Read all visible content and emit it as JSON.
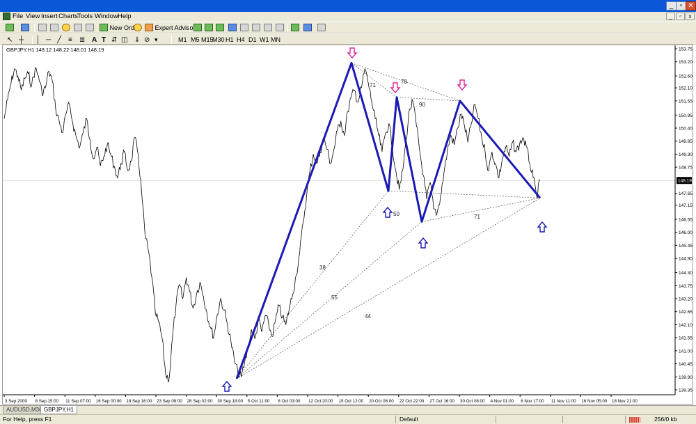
{
  "menu": {
    "items": [
      "File",
      "View",
      "Insert",
      "Charts",
      "Tools",
      "Window",
      "Help"
    ]
  },
  "toolbar": {
    "new_order_label": "New Order",
    "expert_advisors_label": "Expert Advisors",
    "timeframes": [
      "M1",
      "M5",
      "M15",
      "M30",
      "H1",
      "H4",
      "D1",
      "W1",
      "MN"
    ]
  },
  "chart": {
    "title": "GBPJPY,H1  148.12 148.22 148.01 148.19",
    "current_price_label": "148.19",
    "colors": {
      "price_line": "#000000",
      "pattern_line": "#1a1ab5",
      "down_arrow": "#e0249a",
      "up_arrow": "#1a1ab5",
      "ratio_line": "#555555",
      "price_tag_bg": "#000000"
    }
  },
  "chart_data": {
    "type": "line",
    "symbol": "GBPJPY",
    "timeframe": "H1",
    "ohlc": {
      "open": 148.12,
      "high": 148.22,
      "low": 148.01,
      "close": 148.19
    },
    "y_ticks": [
      "153.75",
      "153.20",
      "152.60",
      "152.10",
      "151.55",
      "150.95",
      "150.40",
      "149.85",
      "149.30",
      "148.75",
      "147.65",
      "147.15",
      "146.55",
      "146.00",
      "145.45",
      "144.90",
      "144.30",
      "143.75",
      "143.20",
      "142.65",
      "142.10",
      "141.55",
      "141.00",
      "140.45",
      "139.90",
      "139.35"
    ],
    "x_ticks": [
      "3 Sep 2009",
      "8 Sep 15:00",
      "11 Sep 07:00",
      "16 Sep 00:00",
      "18 Sep 16:00",
      "23 Sep 09:00",
      "28 Sep 02:00",
      "30 Sep 18:00",
      "5 Oct 11:00",
      "8 Oct 03:00",
      "12 Oct 20:00",
      "15 Oct 12:00",
      "20 Oct 06:00",
      "22 Oct 22:00",
      "27 Oct 16:00",
      "30 Oct 08:00",
      "4 Nov 01:00",
      "6 Nov 17:00",
      "11 Nov 11:00",
      "16 Nov 05:00",
      "18 Nov 21:00"
    ],
    "y_range": [
      139.35,
      153.75
    ],
    "current_price": 148.19,
    "pivots": [
      {
        "x": "7 Oct",
        "y": 139.82,
        "kind": "low"
      },
      {
        "x": "22 Oct",
        "y": 153.15,
        "kind": "high"
      },
      {
        "x": "29 Oct",
        "y": 147.75,
        "kind": "low"
      },
      {
        "x": "30 Oct",
        "y": 151.7,
        "kind": "high"
      },
      {
        "x": "4 Nov",
        "y": 146.45,
        "kind": "low"
      },
      {
        "x": "9 Nov",
        "y": 151.55,
        "kind": "high"
      },
      {
        "x": "18 Nov",
        "y": 147.45,
        "kind": "low"
      }
    ],
    "ratio_labels": [
      {
        "text": "78"
      },
      {
        "text": "71"
      },
      {
        "text": "90"
      },
      {
        "text": "50"
      },
      {
        "text": "71"
      },
      {
        "text": "38"
      },
      {
        "text": "55"
      },
      {
        "text": "44"
      }
    ],
    "series": [
      {
        "values": [
          150.8,
          151.6,
          152.3,
          152.9,
          152.6,
          152.0,
          152.5,
          152.7,
          152.2,
          152.9,
          152.6,
          151.9,
          152.1,
          152.8,
          152.4,
          151.2,
          150.7,
          150.2,
          151.0,
          151.4,
          150.6,
          150.0,
          149.6,
          150.2,
          150.8,
          149.9,
          149.1,
          149.6,
          148.8,
          149.2,
          149.7,
          149.3,
          148.8,
          148.3,
          148.9,
          149.4,
          148.6,
          149.0,
          150.0,
          149.3,
          147.7,
          145.9,
          145.2,
          144.1,
          142.6,
          142.2,
          141.5,
          140.0,
          139.8,
          141.6,
          142.9,
          143.8,
          143.2,
          144.1,
          143.5,
          142.8,
          143.4,
          143.9,
          143.3,
          142.6,
          142.0,
          141.6,
          142.5,
          143.2,
          142.7,
          142.1,
          141.4,
          140.6,
          140.1,
          139.9,
          140.5,
          141.1,
          141.9,
          141.5,
          142.3,
          141.8,
          142.5,
          142.1,
          141.6,
          142.3,
          142.9,
          142.4,
          142.1,
          142.8,
          143.4,
          144.2,
          145.1,
          146.4,
          147.5,
          148.6,
          149.3,
          148.9,
          149.4,
          150.0,
          149.5,
          148.9,
          149.5,
          150.3,
          150.7,
          150.1,
          151.1,
          151.7,
          152.0,
          151.5,
          152.1,
          152.9,
          152.3,
          151.5,
          150.8,
          150.1,
          149.4,
          150.2,
          150.6,
          149.6,
          148.6,
          147.8,
          148.6,
          149.9,
          151.2,
          151.5,
          150.5,
          149.4,
          148.4,
          147.4,
          148.1,
          147.0,
          146.8,
          147.5,
          148.5,
          149.4,
          150.1,
          149.7,
          150.4,
          151.0,
          150.5,
          149.8,
          150.6,
          151.4,
          150.8,
          150.0,
          149.4,
          148.6,
          149.4,
          148.9,
          148.3,
          149.1,
          149.6,
          149.2,
          149.8,
          149.4,
          149.7,
          150.0,
          149.6,
          148.9,
          148.3,
          147.5,
          148.2
        ]
      }
    ]
  }
}
